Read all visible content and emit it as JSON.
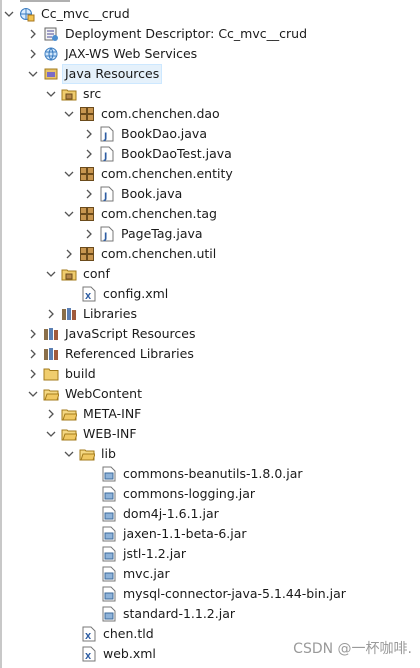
{
  "project": {
    "name": "Cc_mvc__crud",
    "children": [
      {
        "label": "Deployment Descriptor: Cc_mvc__crud",
        "icon": "deployment-descriptor-icon"
      },
      {
        "label": "JAX-WS Web Services",
        "icon": "web-services-icon"
      },
      {
        "label": "Java Resources",
        "icon": "java-resources-icon",
        "selected": true
      }
    ]
  },
  "java_resources": {
    "src": "src",
    "packages": [
      {
        "name": "com.chenchen.dao",
        "files": [
          "BookDao.java",
          "BookDaoTest.java"
        ]
      },
      {
        "name": "com.chenchen.entity",
        "files": [
          "Book.java"
        ]
      },
      {
        "name": "com.chenchen.tag",
        "files": [
          "PageTag.java"
        ]
      },
      {
        "name": "com.chenchen.util",
        "files": []
      }
    ],
    "conf": "conf",
    "conf_files": [
      "config.xml"
    ],
    "libraries": "Libraries"
  },
  "other_nodes": {
    "javascript_resources": "JavaScript Resources",
    "referenced_libraries": "Referenced Libraries",
    "build": "build",
    "webcontent": "WebContent",
    "meta_inf": "META-INF",
    "web_inf": "WEB-INF",
    "lib": "lib"
  },
  "jars": [
    "commons-beanutils-1.8.0.jar",
    "commons-logging.jar",
    "dom4j-1.6.1.jar",
    "jaxen-1.1-beta-6.jar",
    "jstl-1.2.jar",
    "mvc.jar",
    "mysql-connector-java-5.1.44-bin.jar",
    "standard-1.1.2.jar"
  ],
  "web_inf_files": [
    "chen.tld",
    "web.xml"
  ],
  "watermark": "CSDN @一杯咖啡."
}
